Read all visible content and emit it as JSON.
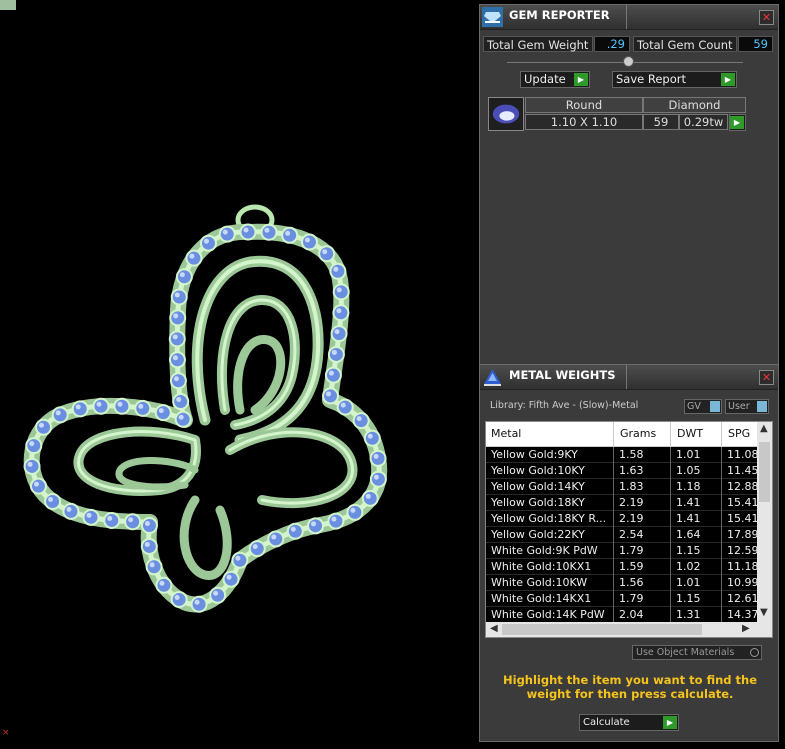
{
  "gem_reporter": {
    "title": "GEM REPORTER",
    "total_gem_weight_label": "Total Gem Weight",
    "total_gem_weight_value": ".29",
    "total_gem_count_label": "Total Gem Count",
    "total_gem_count_value": "59",
    "update_label": "Update",
    "save_report_label": "Save Report",
    "gem_row": {
      "shape": "Round",
      "type": "Diamond",
      "size": "1.10 X 1.10",
      "count": "59",
      "weight": "0.29tw"
    }
  },
  "metal_weights": {
    "title": "METAL WEIGHTS",
    "library_label": "Library: Fifth Ave - (Slow)-Metal",
    "gv_label": "GV",
    "user_label": "User",
    "columns": [
      "Metal",
      "Grams",
      "DWT",
      "SPG"
    ],
    "rows": [
      [
        "Yellow Gold:9KY",
        "1.58",
        "1.01",
        "11.08"
      ],
      [
        "Yellow Gold:10KY",
        "1.63",
        "1.05",
        "11.45"
      ],
      [
        "Yellow Gold:14KY",
        "1.83",
        "1.18",
        "12.88"
      ],
      [
        "Yellow Gold:18KY",
        "2.19",
        "1.41",
        "15.41"
      ],
      [
        "Yellow Gold:18KY R...",
        "2.19",
        "1.41",
        "15.41"
      ],
      [
        "Yellow Gold:22KY",
        "2.54",
        "1.64",
        "17.89"
      ],
      [
        "White Gold:9K PdW",
        "1.79",
        "1.15",
        "12.59"
      ],
      [
        "White Gold:10KX1",
        "1.59",
        "1.02",
        "11.18"
      ],
      [
        "White Gold:10KW",
        "1.56",
        "1.01",
        "10.99"
      ],
      [
        "White Gold:14KX1",
        "1.79",
        "1.15",
        "12.61"
      ],
      [
        "White Gold:14K PdW",
        "2.04",
        "1.31",
        "14.37"
      ]
    ],
    "use_object_materials_label": "Use Object Materials",
    "hint": "Highlight the item you want to find the weight for then press calculate.",
    "calculate_label": "Calculate"
  },
  "colors": {
    "metal_green": "#b8e8b0",
    "gem_blue": "#6a8fe0",
    "hint_yellow": "#f6c31b",
    "value_cyan": "#52c8ff",
    "go_green": "#2f9a2a"
  }
}
